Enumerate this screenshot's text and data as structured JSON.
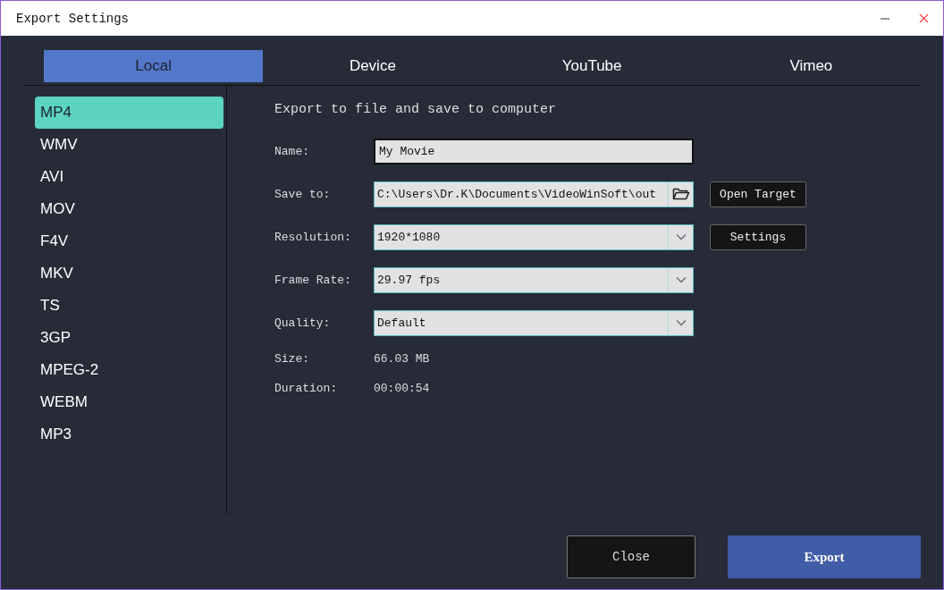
{
  "window": {
    "title": "Export Settings"
  },
  "tabs": [
    {
      "label": "Local",
      "selected": true
    },
    {
      "label": "Device",
      "selected": false
    },
    {
      "label": "YouTube",
      "selected": false
    },
    {
      "label": "Vimeo",
      "selected": false
    }
  ],
  "formats": [
    {
      "label": "MP4",
      "selected": true
    },
    {
      "label": "WMV",
      "selected": false
    },
    {
      "label": "AVI",
      "selected": false
    },
    {
      "label": "MOV",
      "selected": false
    },
    {
      "label": "F4V",
      "selected": false
    },
    {
      "label": "MKV",
      "selected": false
    },
    {
      "label": "TS",
      "selected": false
    },
    {
      "label": "3GP",
      "selected": false
    },
    {
      "label": "MPEG-2",
      "selected": false
    },
    {
      "label": "WEBM",
      "selected": false
    },
    {
      "label": "MP3",
      "selected": false
    }
  ],
  "heading": "Export to file and save to computer",
  "fields": [
    {
      "kind": "text",
      "label": "Name:",
      "value": "My Movie"
    },
    {
      "kind": "path",
      "label": "Save to:",
      "value": "C:\\Users\\Dr.K\\Documents\\VideoWinSoft\\out",
      "button": "Open Target"
    },
    {
      "kind": "select",
      "label": "Resolution:",
      "value": "1920*1080",
      "button": "Settings"
    },
    {
      "kind": "select",
      "label": "Frame Rate:",
      "value": "29.97 fps"
    },
    {
      "kind": "select",
      "label": "Quality:",
      "value": "Default"
    }
  ],
  "info": [
    {
      "label": "Size:",
      "value": "66.03 MB"
    },
    {
      "label": "Duration:",
      "value": "00:00:54"
    }
  ],
  "buttons": {
    "close": "Close",
    "export": "Export"
  }
}
